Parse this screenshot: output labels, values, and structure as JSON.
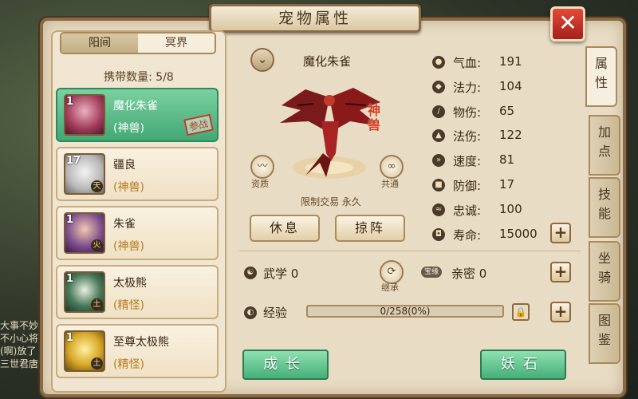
{
  "window": {
    "title": "宠物属性",
    "close_label": "✕"
  },
  "realm_tabs": [
    {
      "label": "阳间",
      "active": true
    },
    {
      "label": "冥界",
      "active": false
    }
  ],
  "carry": {
    "text": "携带数量: 5/8"
  },
  "pets": [
    {
      "level": "1",
      "name": "魔化朱雀",
      "type": "(神兽)",
      "selected": true,
      "badge": "参战",
      "color": "#a33a5a"
    },
    {
      "level": "17",
      "name": "疆良",
      "type": "(神兽)",
      "selected": false,
      "element": "天",
      "color": "#d8d8d8"
    },
    {
      "level": "1",
      "name": "朱雀",
      "type": "(神兽)",
      "selected": false,
      "element": "火",
      "color": "#7a4a8a"
    },
    {
      "level": "1",
      "name": "太极熊",
      "type": "(精怪)",
      "selected": false,
      "element": "土",
      "color": "#4a7a5a"
    },
    {
      "level": "1",
      "name": "至尊太极熊",
      "type": "(精怪)",
      "selected": false,
      "element": "土",
      "color": "#d8a828"
    }
  ],
  "pet_view": {
    "name": "魔化朱雀",
    "category_tag": "神兽",
    "left_icon_label": "资质",
    "right_icon_label": "共通",
    "trade_text": "限制交易 永久",
    "rest_button": "休息",
    "battle_button": "掠阵"
  },
  "stats": [
    {
      "label": "气血:",
      "value": "191",
      "icon": "blood-icon"
    },
    {
      "label": "法力:",
      "value": "104",
      "icon": "mana-icon"
    },
    {
      "label": "物伤:",
      "value": "65",
      "icon": "sword-icon"
    },
    {
      "label": "法伤:",
      "value": "122",
      "icon": "fire-icon"
    },
    {
      "label": "速度:",
      "value": "81",
      "icon": "speed-icon"
    },
    {
      "label": "防御:",
      "value": "17",
      "icon": "shield-icon"
    },
    {
      "label": "忠诚:",
      "value": "100",
      "icon": "handshake-icon"
    },
    {
      "label": "寿命:",
      "value": "15000",
      "icon": "lifespan-icon"
    }
  ],
  "martial": {
    "label": "武学 0"
  },
  "inherit": {
    "label": "继承"
  },
  "intimacy": {
    "label": "亲密 0",
    "tag": "宝缘"
  },
  "experience": {
    "label": "经验",
    "text": "0/258(0%)",
    "fraction": 0
  },
  "buttons": {
    "grow": "成长",
    "stone": "妖石"
  },
  "side_tabs": [
    {
      "label": "属性",
      "active": true
    },
    {
      "label": "加点",
      "active": false
    },
    {
      "label": "技能",
      "active": false
    },
    {
      "label": "坐骑",
      "active": false
    },
    {
      "label": "图鉴",
      "active": false
    }
  ],
  "chat_lines": [
    "大事不妙",
    "不小心将",
    "(啊)放了",
    "三世君唐"
  ]
}
